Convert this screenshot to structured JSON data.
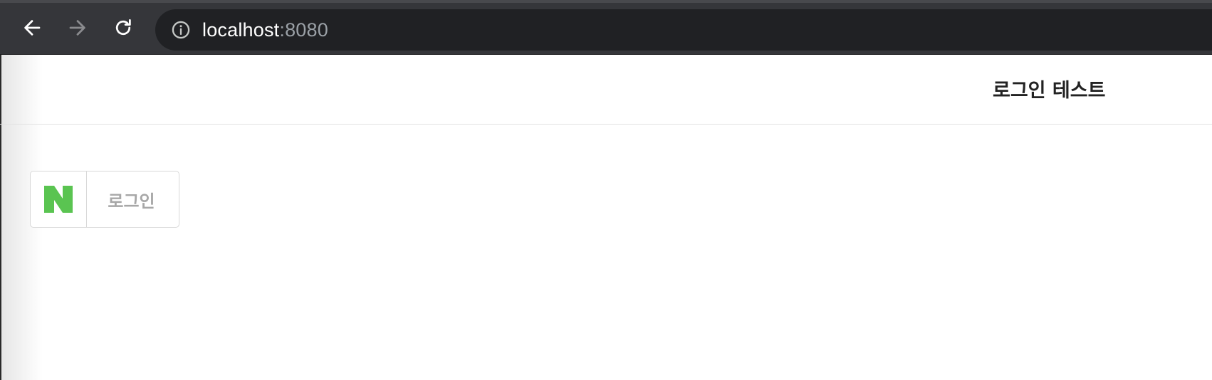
{
  "browser": {
    "url_host": "localhost",
    "url_port": ":8080",
    "back_icon": "arrow-left-icon",
    "forward_icon": "arrow-right-icon",
    "reload_icon": "reload-icon",
    "info_icon": "info-circle-icon"
  },
  "page": {
    "title": "로그인 테스트"
  },
  "login": {
    "logo_icon": "naver-n-logo-icon",
    "label": "로그인",
    "brand_color": "#5ac451",
    "label_color": "#a7a7a7"
  }
}
